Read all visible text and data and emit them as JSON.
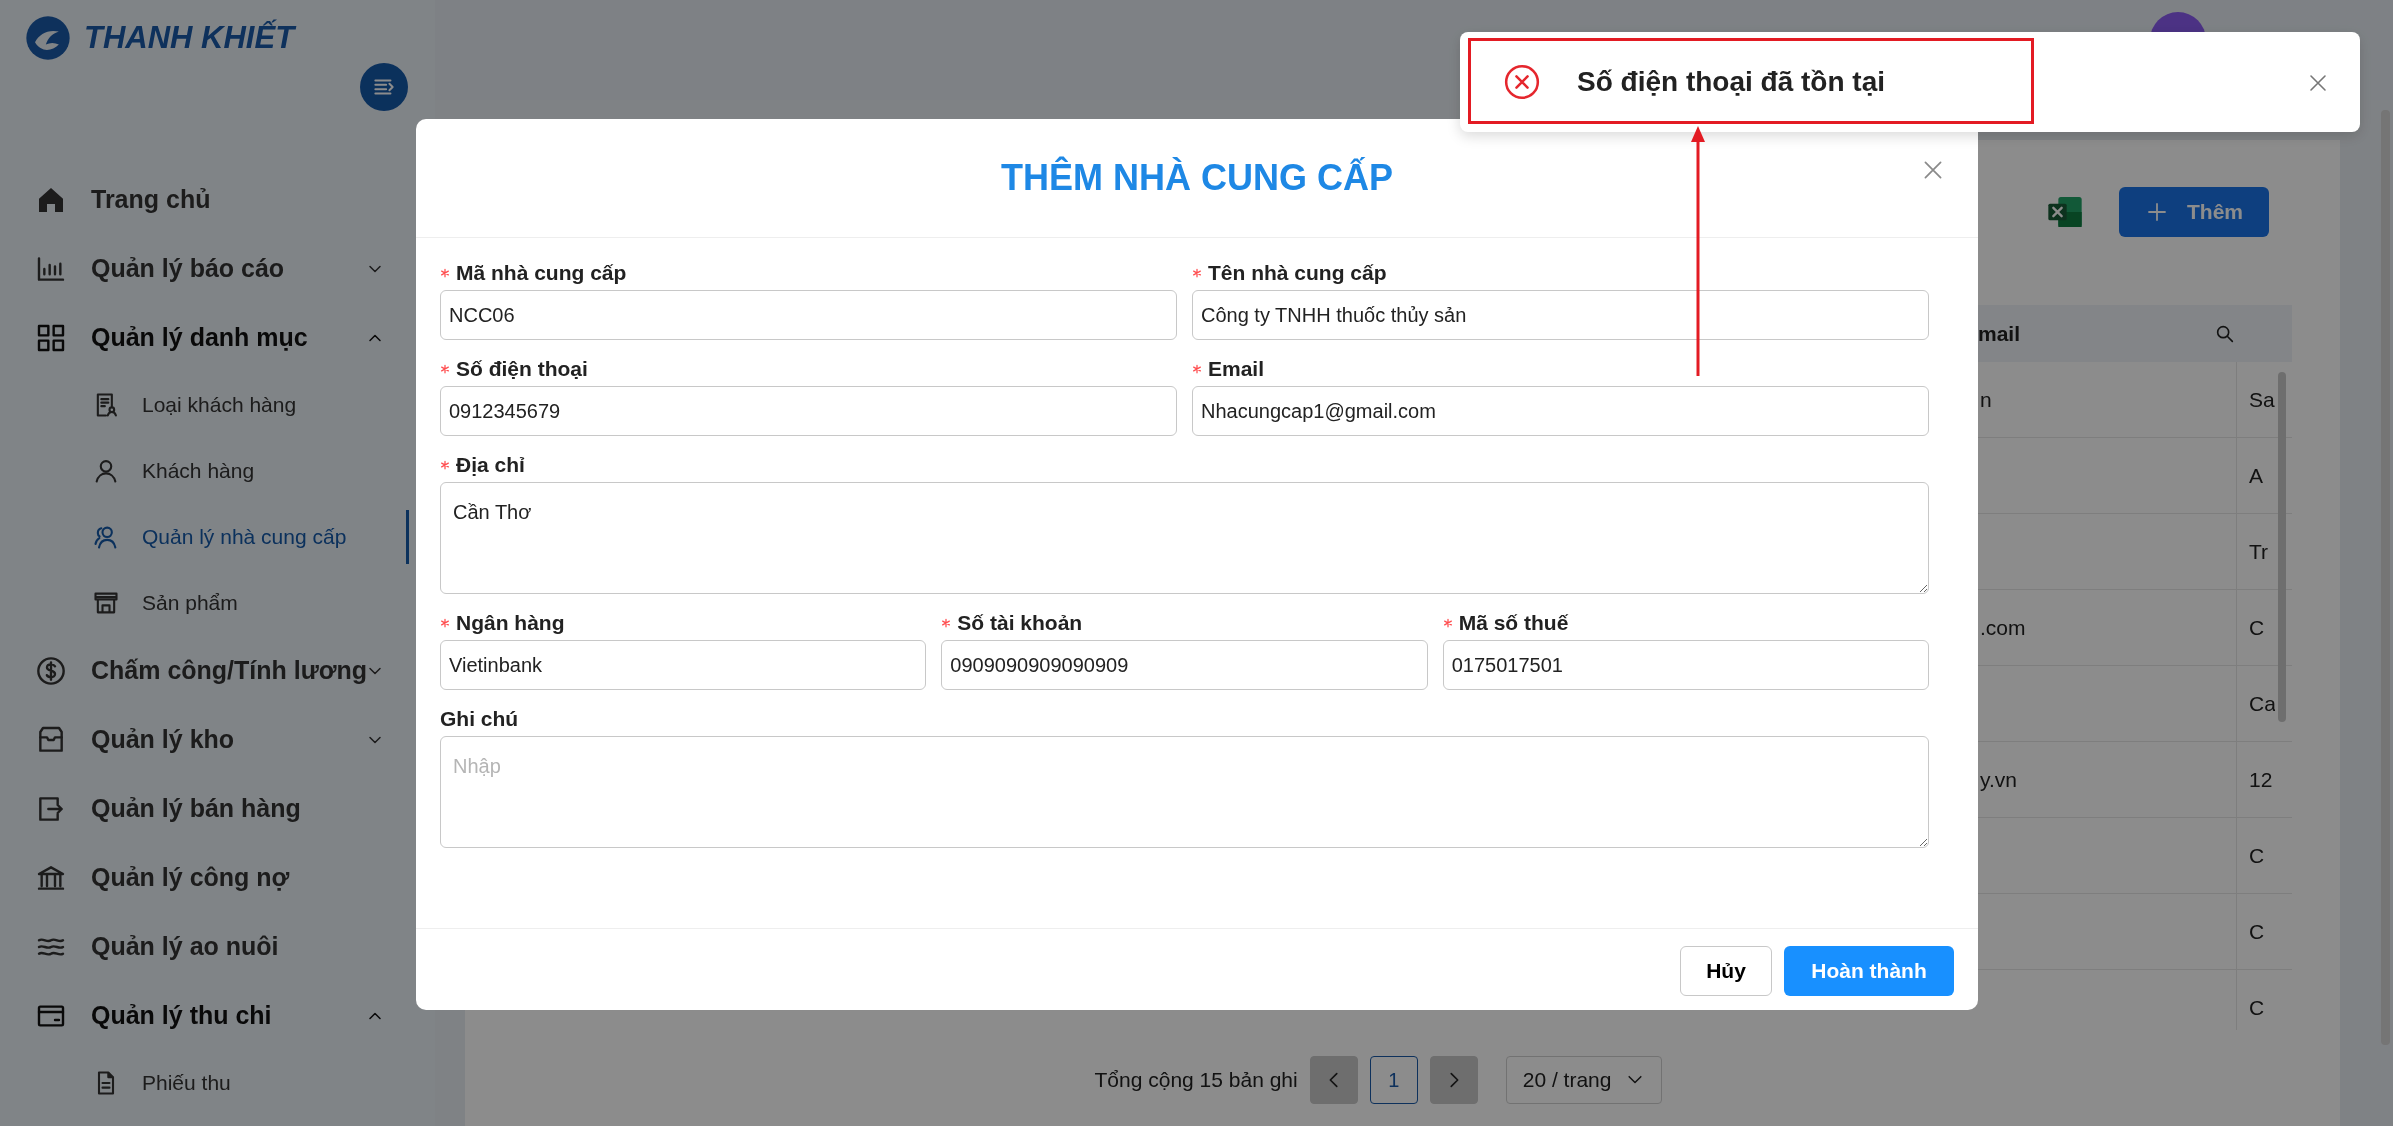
{
  "sidebar": {
    "logo": "THANH KHIẾT",
    "items": [
      {
        "label": "Trang chủ",
        "selected": false
      },
      {
        "label": "Quản lý báo cáo",
        "selected": false,
        "expanded": false
      },
      {
        "label": "Quản lý danh mục",
        "selected": false,
        "expanded": true,
        "children": [
          {
            "label": "Loại khách hàng",
            "selected": false
          },
          {
            "label": "Khách hàng",
            "selected": false
          },
          {
            "label": "Quản lý nhà cung cấp",
            "selected": true
          },
          {
            "label": "Sản phẩm",
            "selected": false
          }
        ]
      },
      {
        "label": "Chấm công/Tính lương",
        "selected": false,
        "expanded": false
      },
      {
        "label": "Quản lý kho",
        "selected": false,
        "expanded": false
      },
      {
        "label": "Quản lý bán hàng",
        "selected": false
      },
      {
        "label": "Quản lý công nợ",
        "selected": false
      },
      {
        "label": "Quản lý ao nuôi",
        "selected": false
      },
      {
        "label": "Quản lý thu chi",
        "selected": false,
        "expanded": true,
        "children": [
          {
            "label": "Phiếu thu",
            "selected": false
          }
        ]
      }
    ]
  },
  "toolbar": {
    "add_button": "Thêm"
  },
  "table": {
    "columns": [
      {
        "label": "mail"
      }
    ],
    "rows": [
      {
        "column_1": "n",
        "column_2": "Sa"
      },
      {
        "column_2": "A"
      },
      {
        "column_2": "Tr"
      },
      {
        "column_1": ".com",
        "column_2": "C"
      },
      {
        "column_2": "Ca"
      },
      {
        "column_1": "y.vn",
        "column_2": "12"
      },
      {
        "column_2": "C"
      },
      {
        "column_2": "C"
      },
      {
        "column_2": "C"
      }
    ]
  },
  "pagination": {
    "total": "Tổng cộng 15 bản ghi",
    "prev_disabled": true,
    "pages": [
      {
        "label": "1",
        "selected": true
      }
    ],
    "next_disabled": true,
    "page_size": "20 / trang"
  },
  "modal": {
    "title": "THÊM NHÀ CUNG CẤP",
    "rows": [
      {
        "fields": [
          {
            "label": "Mã nhà cung cấp",
            "required": true,
            "kind": "input",
            "value": "NCC06"
          },
          {
            "label": "Tên nhà cung cấp",
            "required": true,
            "kind": "input",
            "value": "Công ty TNHH thuốc thủy sản"
          }
        ]
      },
      {
        "fields": [
          {
            "label": "Số điện thoại",
            "required": true,
            "kind": "input",
            "value": "0912345679"
          },
          {
            "label": "Email",
            "required": true,
            "kind": "input",
            "value": "Nhacungcap1@gmail.com"
          }
        ]
      },
      {
        "fields": [
          {
            "label": "Địa chỉ",
            "required": true,
            "kind": "textarea",
            "value": "Cần Thơ"
          }
        ]
      },
      {
        "fields": [
          {
            "label": "Ngân hàng",
            "required": true,
            "kind": "input",
            "value": "Vietinbank"
          },
          {
            "label": "Số tài khoản",
            "required": true,
            "kind": "input",
            "value": "0909090909090909"
          },
          {
            "label": "Mã số thuế",
            "required": true,
            "kind": "input",
            "value": "0175017501"
          }
        ]
      },
      {
        "fields": [
          {
            "label": "Ghi chú",
            "required": false,
            "kind": "textarea",
            "placeholder": "Nhập"
          }
        ]
      }
    ],
    "cancel": "Hủy",
    "submit": "Hoàn thành"
  },
  "toast": {
    "kind": "error",
    "message": "Số điện thoại đã tồn tại"
  }
}
